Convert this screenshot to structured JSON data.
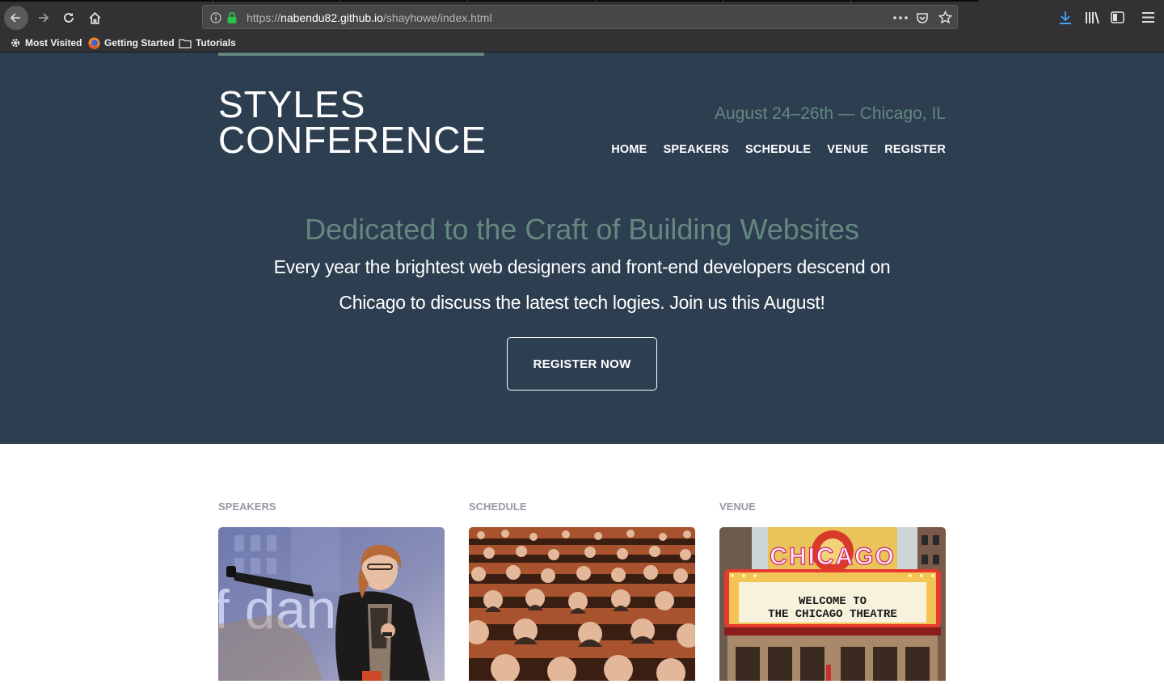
{
  "browser": {
    "url_scheme": "https://",
    "url_host": "nabendu82.github.io",
    "url_path": "/shayhowe/index.html",
    "bookmarks": [
      {
        "label": "Most Visited",
        "icon": "gear-icon"
      },
      {
        "label": "Getting Started",
        "icon": "firefox-icon"
      },
      {
        "label": "Tutorials",
        "icon": "folder-icon"
      }
    ]
  },
  "header": {
    "logo_line1": "STYLES",
    "logo_line2": "CONFERENCE",
    "tagline": "August 24–26th — Chicago, IL",
    "nav": [
      "HOME",
      "SPEAKERS",
      "SCHEDULE",
      "VENUE",
      "REGISTER"
    ]
  },
  "hero": {
    "title": "Dedicated to the Craft of Building Websites",
    "text": "Every year the brightest web designers and front-end developers descend on Chicago to discuss the latest tech logies. Join us this August!",
    "button": "REGISTER NOW"
  },
  "teasers": [
    {
      "heading": "SPEAKERS",
      "image": "speaker-photo"
    },
    {
      "heading": "SCHEDULE",
      "image": "audience-photo"
    },
    {
      "heading": "VENUE",
      "image": "chicago-theatre-photo",
      "sign_line1": "CHICAGO",
      "sign_line2": "WELCOME  TO",
      "sign_line3": "THE CHICAGO  THEATRE"
    }
  ],
  "colors": {
    "hero_bg": "#2d3e50",
    "accent_green": "#648880",
    "teaser_heading": "#9799a7",
    "chrome_bg": "#323234"
  }
}
